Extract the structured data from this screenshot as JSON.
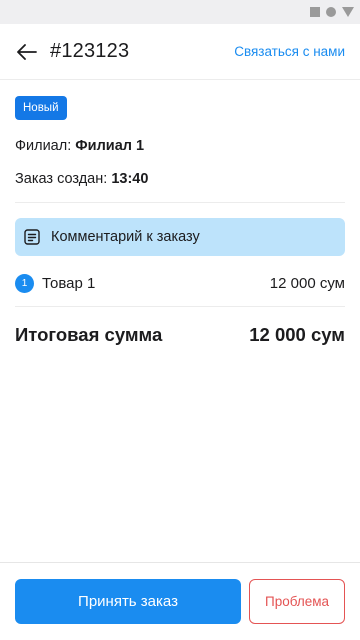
{
  "header": {
    "title": "#123123",
    "contact_label": "Связаться с нами",
    "back_icon": "arrow-left-icon"
  },
  "order": {
    "status": "Новый",
    "branch_label": "Филиал:",
    "branch_value": "Филиал 1",
    "created_label": "Заказ создан:",
    "created_value": "13:40"
  },
  "comment": {
    "label": "Комментарий к заказу",
    "icon": "note-icon"
  },
  "items": [
    {
      "index": "1",
      "name": "Товар 1",
      "price": "12 000 сум"
    }
  ],
  "total": {
    "label": "Итоговая сумма",
    "value": "12 000 сум"
  },
  "footer": {
    "accept_label": "Принять заказ",
    "problem_label": "Проблема"
  },
  "colors": {
    "accent": "#1a8cf0",
    "badge": "#1478e6",
    "comment_bg": "#bde3fb",
    "danger": "#e45454"
  }
}
